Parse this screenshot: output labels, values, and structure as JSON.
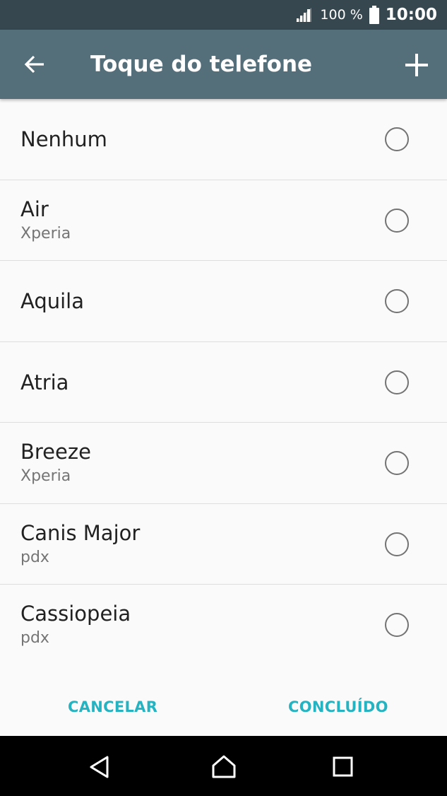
{
  "status_bar": {
    "battery_percent": "100 %",
    "time": "10:00",
    "icons": [
      "signal-icon",
      "battery-icon"
    ]
  },
  "toolbar": {
    "title": "Toque do telefone",
    "back_icon": "arrow-left-icon",
    "add_icon": "plus-icon"
  },
  "ringtones": [
    {
      "name": "Nenhum",
      "source": "",
      "selected": false
    },
    {
      "name": "Air",
      "source": "Xperia",
      "selected": false
    },
    {
      "name": "Aquila",
      "source": "",
      "selected": false
    },
    {
      "name": "Atria",
      "source": "",
      "selected": false
    },
    {
      "name": "Breeze",
      "source": "Xperia",
      "selected": false
    },
    {
      "name": "Canis Major",
      "source": "pdx",
      "selected": false
    },
    {
      "name": "Cassiopeia",
      "source": "pdx",
      "selected": false
    }
  ],
  "actions": {
    "cancel_label": "CANCELAR",
    "done_label": "CONCLUÍDO"
  },
  "nav_bar": {
    "icons": [
      "back-triangle-icon",
      "home-icon",
      "recent-apps-icon"
    ]
  },
  "colors": {
    "status_bar": "#37474f",
    "toolbar": "#546e7a",
    "accent": "#26b3c1"
  }
}
